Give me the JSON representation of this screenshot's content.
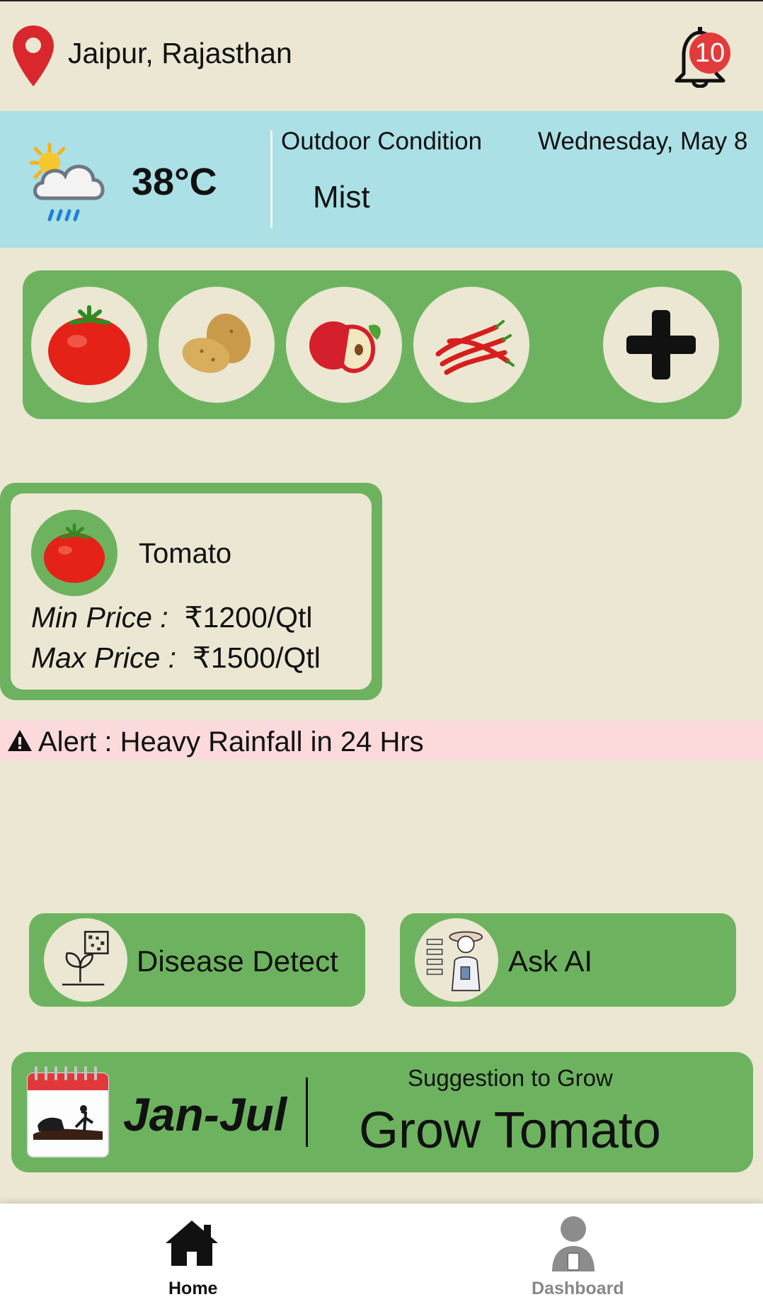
{
  "header": {
    "location": "Jaipur, Rajasthan",
    "notification_count": "10",
    "icons": {
      "location": "map-pin-icon",
      "notifications": "bell-icon"
    }
  },
  "weather": {
    "temperature": "38°C",
    "condition_label": "Outdoor Condition",
    "date": "Wednesday, May 8",
    "condition": "Mist",
    "icon": "sun-cloud-rain-icon"
  },
  "crops": {
    "items": [
      {
        "name": "tomato",
        "icon": "tomato-icon"
      },
      {
        "name": "potato",
        "icon": "potato-icon"
      },
      {
        "name": "apple",
        "icon": "apple-icon"
      },
      {
        "name": "chili",
        "icon": "chili-icon"
      }
    ],
    "add_icon": "plus-icon"
  },
  "price_card": {
    "crop": "Tomato",
    "min_label": "Min Price :",
    "min_value": "₹1200/Qtl",
    "max_label": "Max Price :",
    "max_value": "₹1500/Qtl"
  },
  "alert": {
    "text": "Alert : Heavy Rainfall in 24 Hrs",
    "icon": "warning-icon"
  },
  "features": {
    "disease_detect": "Disease Detect",
    "ask_ai": "Ask AI"
  },
  "suggestion": {
    "season": "Jan-Jul",
    "label": "Suggestion to Grow",
    "value": "Grow Tomato"
  },
  "nav": {
    "home": "Home",
    "dashboard": "Dashboard"
  },
  "colors": {
    "background": "#ebe7d3",
    "green": "#6db35f",
    "weather_bg": "#abe0e6",
    "alert_bg": "#fcdadb",
    "badge": "#e23b3b"
  }
}
